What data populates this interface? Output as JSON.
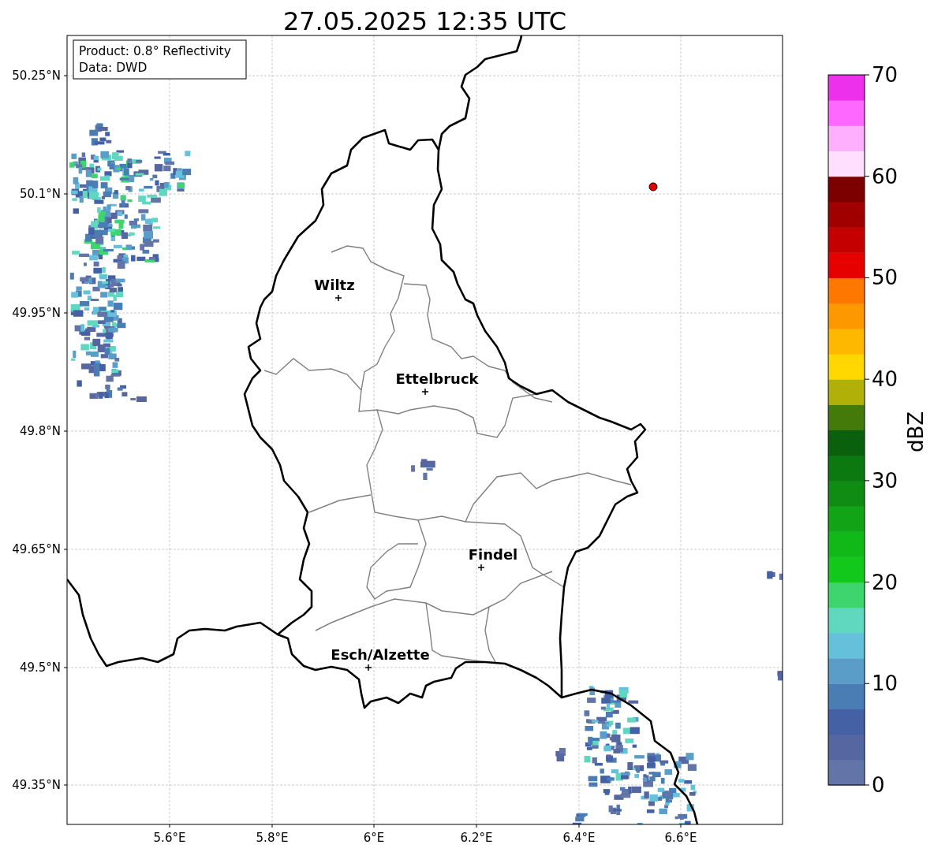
{
  "title": "27.05.2025 12:35 UTC",
  "info": [
    "Product: 0.8° Reflectivity",
    "Data: DWD"
  ],
  "y_ticks": [
    "50.25°N",
    "50.1°N",
    "49.95°N",
    "49.8°N",
    "49.65°N",
    "49.5°N",
    "49.35°N"
  ],
  "x_ticks": [
    "5.6°E",
    "5.8°E",
    "6°E",
    "6.2°E",
    "6.4°E",
    "6.6°E"
  ],
  "places": [
    {
      "name": "Wiltz"
    },
    {
      "name": "Ettelbruck"
    },
    {
      "name": "Findel"
    },
    {
      "name": "Esch/Alzette"
    }
  ],
  "colorbar": {
    "label": "dBZ",
    "ticks": [
      "70",
      "60",
      "50",
      "40",
      "30",
      "20",
      "10",
      "0"
    ],
    "bands": [
      {
        "color": "#6374a8"
      },
      {
        "color": "#5566a0"
      },
      {
        "color": "#4461a6"
      },
      {
        "color": "#4a7db4"
      },
      {
        "color": "#5a9dc8"
      },
      {
        "color": "#65c0dc"
      },
      {
        "color": "#60d8c0"
      },
      {
        "color": "#3ed46e"
      },
      {
        "color": "#12c81a"
      },
      {
        "color": "#10b818"
      },
      {
        "color": "#10a416"
      },
      {
        "color": "#0e8c14"
      },
      {
        "color": "#0c7810"
      },
      {
        "color": "#0a600c"
      },
      {
        "color": "#447a0a"
      },
      {
        "color": "#b0b008"
      },
      {
        "color": "#fed800"
      },
      {
        "color": "#feb800"
      },
      {
        "color": "#fe9800"
      },
      {
        "color": "#fe7800"
      },
      {
        "color": "#e60000"
      },
      {
        "color": "#c40000"
      },
      {
        "color": "#a00000"
      },
      {
        "color": "#7c0000"
      },
      {
        "color": "#fee0fe"
      },
      {
        "color": "#feb0fe"
      },
      {
        "color": "#fe68fe"
      },
      {
        "color": "#ec30ec"
      }
    ]
  }
}
